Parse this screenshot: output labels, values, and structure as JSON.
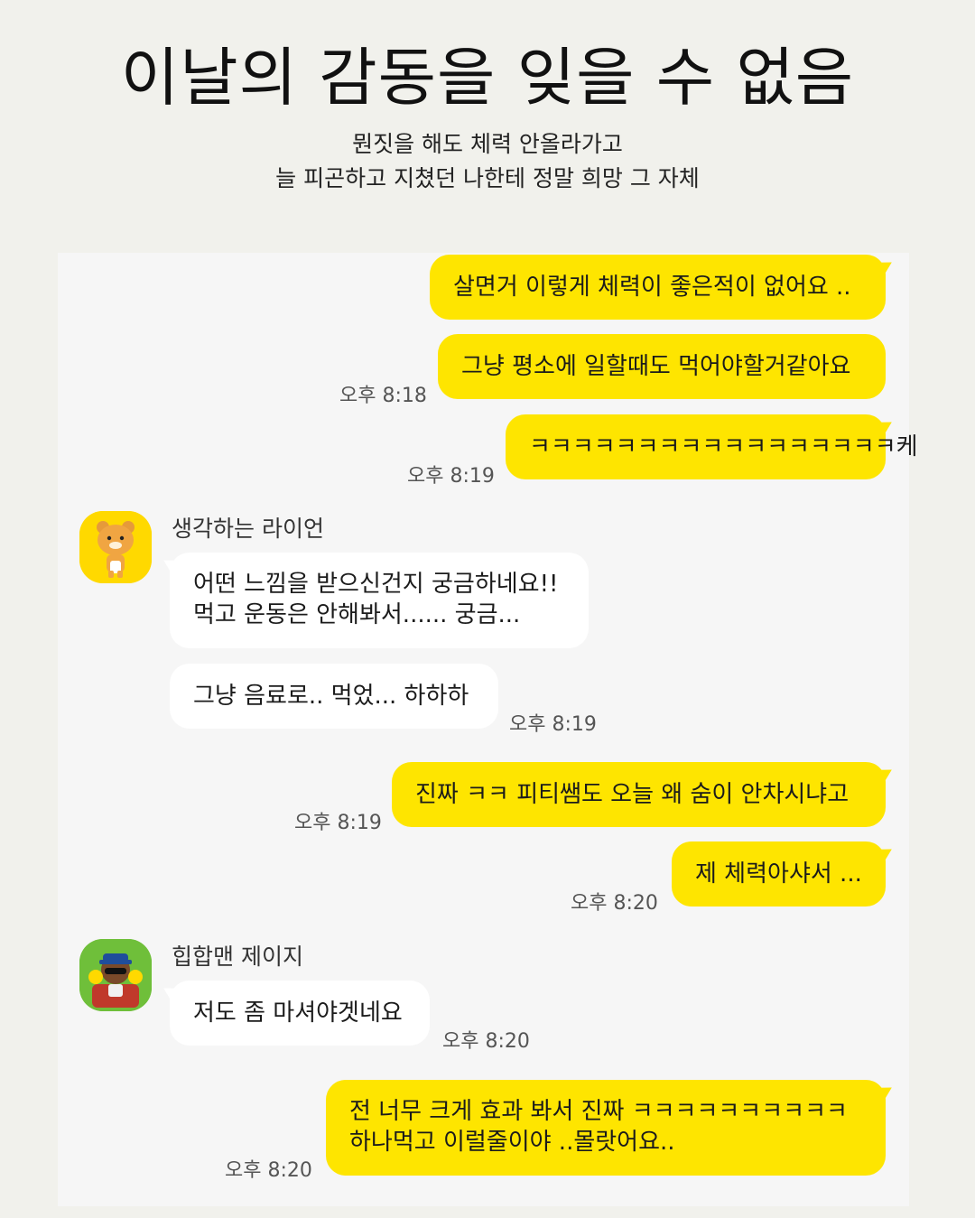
{
  "header": {
    "title": "이날의 감동을 잊을 수 없음",
    "subtitle_line1": "뭔짓을 해도 체력 안올라가고",
    "subtitle_line2": "늘 피곤하고 지쳤던 나한테 정말 희망 그 자체"
  },
  "chat": {
    "messages": [
      {
        "from": "me",
        "text": "살면거 이렇게 체력이 좋은적이 없어요 .."
      },
      {
        "from": "me",
        "text": "그냥 평소에 일할때도 먹어야할거같아요",
        "time": "오후 8:18"
      },
      {
        "from": "me",
        "text": "ㅋㅋㅋㅋㅋㅋㅋㅋㅋㅋㅋㅋㅋㅋㅋㅋㅋ케",
        "time": "오후 8:19"
      },
      {
        "from": "생각하는 라이언",
        "line1": "어떤 느낌을 받으신건지 궁금하네요!!",
        "line2": "먹고 운동은 안해봐서...... 궁금..."
      },
      {
        "from": "생각하는 라이언",
        "text": "그냥 음료로.. 먹었... 하하하",
        "time": "오후 8:19"
      },
      {
        "from": "me",
        "text": "진짜 ㅋㅋ 피티쌤도 오늘 왜 숨이 안차시냐고",
        "time": "오후 8:19"
      },
      {
        "from": "me",
        "text": "제 체력아샤서 ...",
        "time": "오후 8:20"
      },
      {
        "from": "힙합맨 제이지",
        "text": "저도 좀 마셔야겟네요",
        "time": "오후 8:20"
      },
      {
        "from": "me",
        "line1": "전 너무 크게 효과 봐서 진짜 ㅋㅋㅋㅋㅋㅋㅋㅋㅋㅋ",
        "line2": "하나먹고 이럴줄이야 ..몰랏어요..",
        "time": "오후 8:20"
      }
    ],
    "senders": {
      "ryan": "생각하는 라이언",
      "jayz": "힙합맨 제이지"
    }
  },
  "colors": {
    "my_bubble": "#fee500",
    "their_bubble": "#ffffff",
    "chat_background": "#f6f6f6",
    "page_background": "#f1f1ec"
  }
}
